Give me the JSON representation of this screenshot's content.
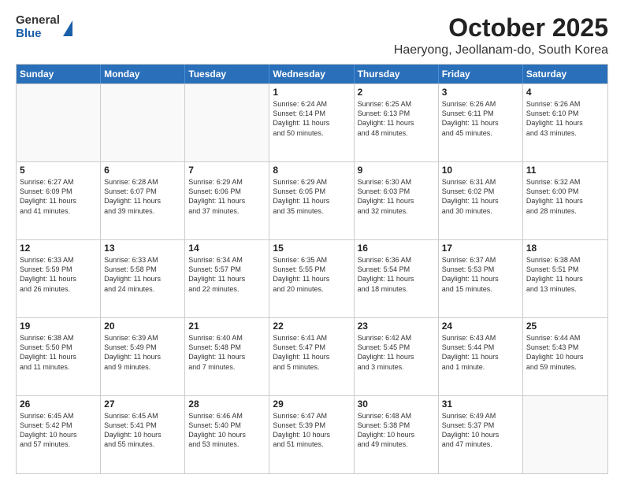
{
  "logo": {
    "general": "General",
    "blue": "Blue"
  },
  "title": "October 2025",
  "location": "Haeryong, Jeollanam-do, South Korea",
  "headers": [
    "Sunday",
    "Monday",
    "Tuesday",
    "Wednesday",
    "Thursday",
    "Friday",
    "Saturday"
  ],
  "rows": [
    [
      {
        "day": "",
        "detail": ""
      },
      {
        "day": "",
        "detail": ""
      },
      {
        "day": "",
        "detail": ""
      },
      {
        "day": "1",
        "detail": "Sunrise: 6:24 AM\nSunset: 6:14 PM\nDaylight: 11 hours\nand 50 minutes."
      },
      {
        "day": "2",
        "detail": "Sunrise: 6:25 AM\nSunset: 6:13 PM\nDaylight: 11 hours\nand 48 minutes."
      },
      {
        "day": "3",
        "detail": "Sunrise: 6:26 AM\nSunset: 6:11 PM\nDaylight: 11 hours\nand 45 minutes."
      },
      {
        "day": "4",
        "detail": "Sunrise: 6:26 AM\nSunset: 6:10 PM\nDaylight: 11 hours\nand 43 minutes."
      }
    ],
    [
      {
        "day": "5",
        "detail": "Sunrise: 6:27 AM\nSunset: 6:09 PM\nDaylight: 11 hours\nand 41 minutes."
      },
      {
        "day": "6",
        "detail": "Sunrise: 6:28 AM\nSunset: 6:07 PM\nDaylight: 11 hours\nand 39 minutes."
      },
      {
        "day": "7",
        "detail": "Sunrise: 6:29 AM\nSunset: 6:06 PM\nDaylight: 11 hours\nand 37 minutes."
      },
      {
        "day": "8",
        "detail": "Sunrise: 6:29 AM\nSunset: 6:05 PM\nDaylight: 11 hours\nand 35 minutes."
      },
      {
        "day": "9",
        "detail": "Sunrise: 6:30 AM\nSunset: 6:03 PM\nDaylight: 11 hours\nand 32 minutes."
      },
      {
        "day": "10",
        "detail": "Sunrise: 6:31 AM\nSunset: 6:02 PM\nDaylight: 11 hours\nand 30 minutes."
      },
      {
        "day": "11",
        "detail": "Sunrise: 6:32 AM\nSunset: 6:00 PM\nDaylight: 11 hours\nand 28 minutes."
      }
    ],
    [
      {
        "day": "12",
        "detail": "Sunrise: 6:33 AM\nSunset: 5:59 PM\nDaylight: 11 hours\nand 26 minutes."
      },
      {
        "day": "13",
        "detail": "Sunrise: 6:33 AM\nSunset: 5:58 PM\nDaylight: 11 hours\nand 24 minutes."
      },
      {
        "day": "14",
        "detail": "Sunrise: 6:34 AM\nSunset: 5:57 PM\nDaylight: 11 hours\nand 22 minutes."
      },
      {
        "day": "15",
        "detail": "Sunrise: 6:35 AM\nSunset: 5:55 PM\nDaylight: 11 hours\nand 20 minutes."
      },
      {
        "day": "16",
        "detail": "Sunrise: 6:36 AM\nSunset: 5:54 PM\nDaylight: 11 hours\nand 18 minutes."
      },
      {
        "day": "17",
        "detail": "Sunrise: 6:37 AM\nSunset: 5:53 PM\nDaylight: 11 hours\nand 15 minutes."
      },
      {
        "day": "18",
        "detail": "Sunrise: 6:38 AM\nSunset: 5:51 PM\nDaylight: 11 hours\nand 13 minutes."
      }
    ],
    [
      {
        "day": "19",
        "detail": "Sunrise: 6:38 AM\nSunset: 5:50 PM\nDaylight: 11 hours\nand 11 minutes."
      },
      {
        "day": "20",
        "detail": "Sunrise: 6:39 AM\nSunset: 5:49 PM\nDaylight: 11 hours\nand 9 minutes."
      },
      {
        "day": "21",
        "detail": "Sunrise: 6:40 AM\nSunset: 5:48 PM\nDaylight: 11 hours\nand 7 minutes."
      },
      {
        "day": "22",
        "detail": "Sunrise: 6:41 AM\nSunset: 5:47 PM\nDaylight: 11 hours\nand 5 minutes."
      },
      {
        "day": "23",
        "detail": "Sunrise: 6:42 AM\nSunset: 5:45 PM\nDaylight: 11 hours\nand 3 minutes."
      },
      {
        "day": "24",
        "detail": "Sunrise: 6:43 AM\nSunset: 5:44 PM\nDaylight: 11 hours\nand 1 minute."
      },
      {
        "day": "25",
        "detail": "Sunrise: 6:44 AM\nSunset: 5:43 PM\nDaylight: 10 hours\nand 59 minutes."
      }
    ],
    [
      {
        "day": "26",
        "detail": "Sunrise: 6:45 AM\nSunset: 5:42 PM\nDaylight: 10 hours\nand 57 minutes."
      },
      {
        "day": "27",
        "detail": "Sunrise: 6:45 AM\nSunset: 5:41 PM\nDaylight: 10 hours\nand 55 minutes."
      },
      {
        "day": "28",
        "detail": "Sunrise: 6:46 AM\nSunset: 5:40 PM\nDaylight: 10 hours\nand 53 minutes."
      },
      {
        "day": "29",
        "detail": "Sunrise: 6:47 AM\nSunset: 5:39 PM\nDaylight: 10 hours\nand 51 minutes."
      },
      {
        "day": "30",
        "detail": "Sunrise: 6:48 AM\nSunset: 5:38 PM\nDaylight: 10 hours\nand 49 minutes."
      },
      {
        "day": "31",
        "detail": "Sunrise: 6:49 AM\nSunset: 5:37 PM\nDaylight: 10 hours\nand 47 minutes."
      },
      {
        "day": "",
        "detail": ""
      }
    ]
  ]
}
